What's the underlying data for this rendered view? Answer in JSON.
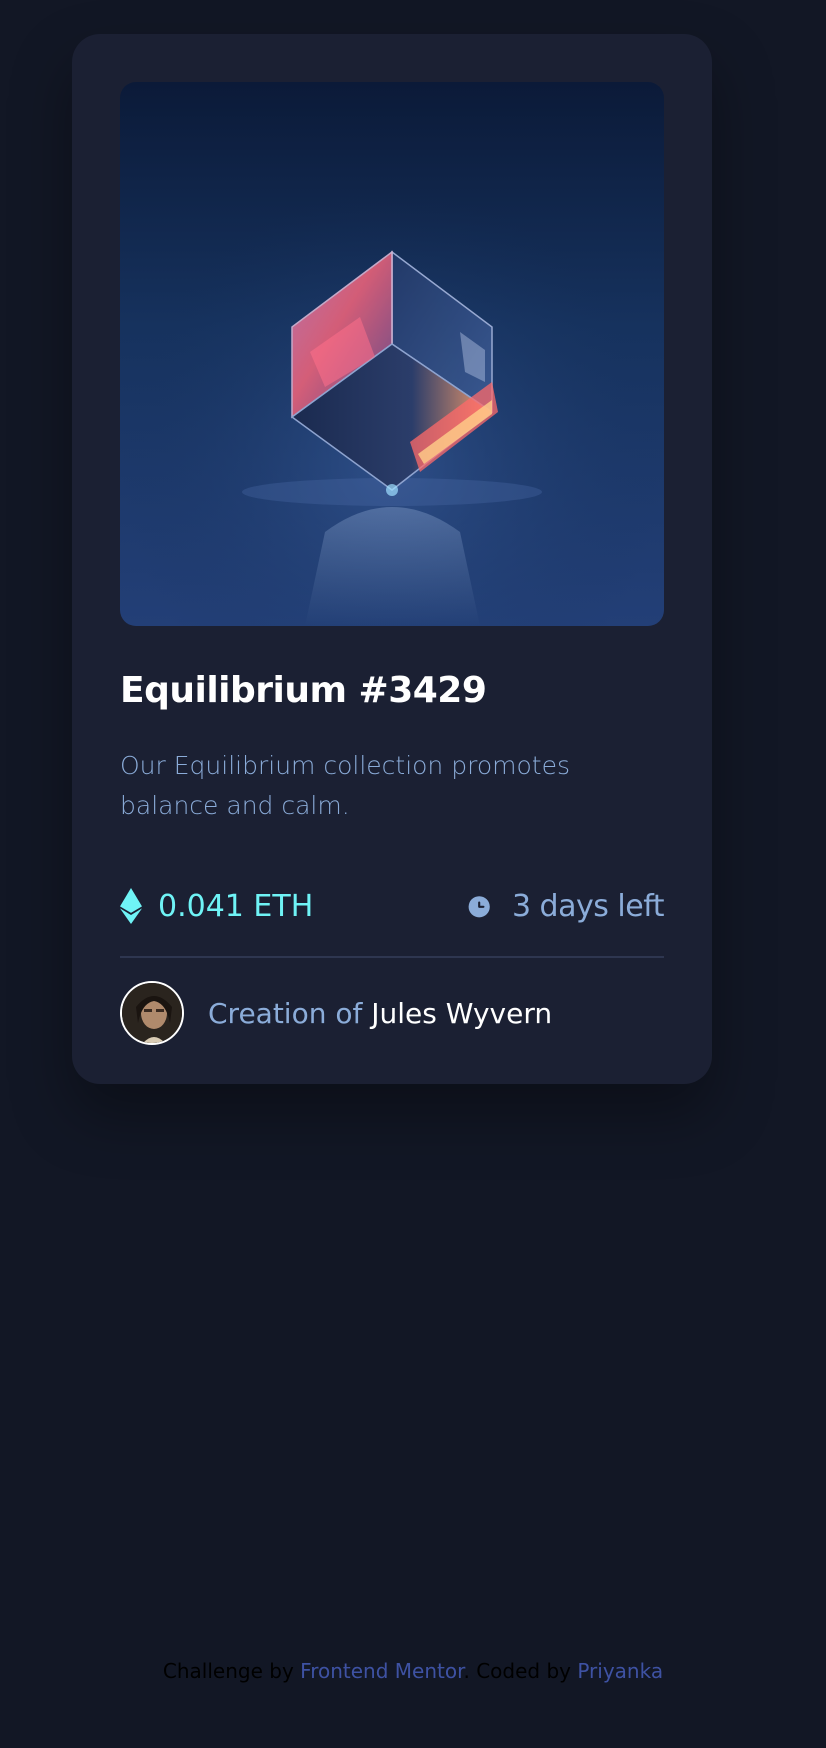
{
  "card": {
    "image_alt": "Equilibrium cube image",
    "title": "Equilibrium #3429",
    "description": "Our Equilibrium collection promotes balance and calm.",
    "price": {
      "icon": "ethereum-icon",
      "value": "0.041 ETH",
      "color": "#6ff3f6"
    },
    "time": {
      "icon": "clock-icon",
      "value": "3 days left"
    },
    "creator": {
      "prefix": "Creation of",
      "name": "Jules Wyvern",
      "avatar": "avatar"
    }
  },
  "attribution": {
    "challenge_by": "Challenge by",
    "challenge_link": "Frontend Mentor",
    "coded_by": ". Coded by",
    "coder_link": "Priyanka"
  },
  "colors": {
    "background": "#121725",
    "card": "#1b2033",
    "soft_blue": "#8bacd9",
    "cyan": "#6ff3f6",
    "white": "#ffffff",
    "link": "#3e52a3"
  }
}
